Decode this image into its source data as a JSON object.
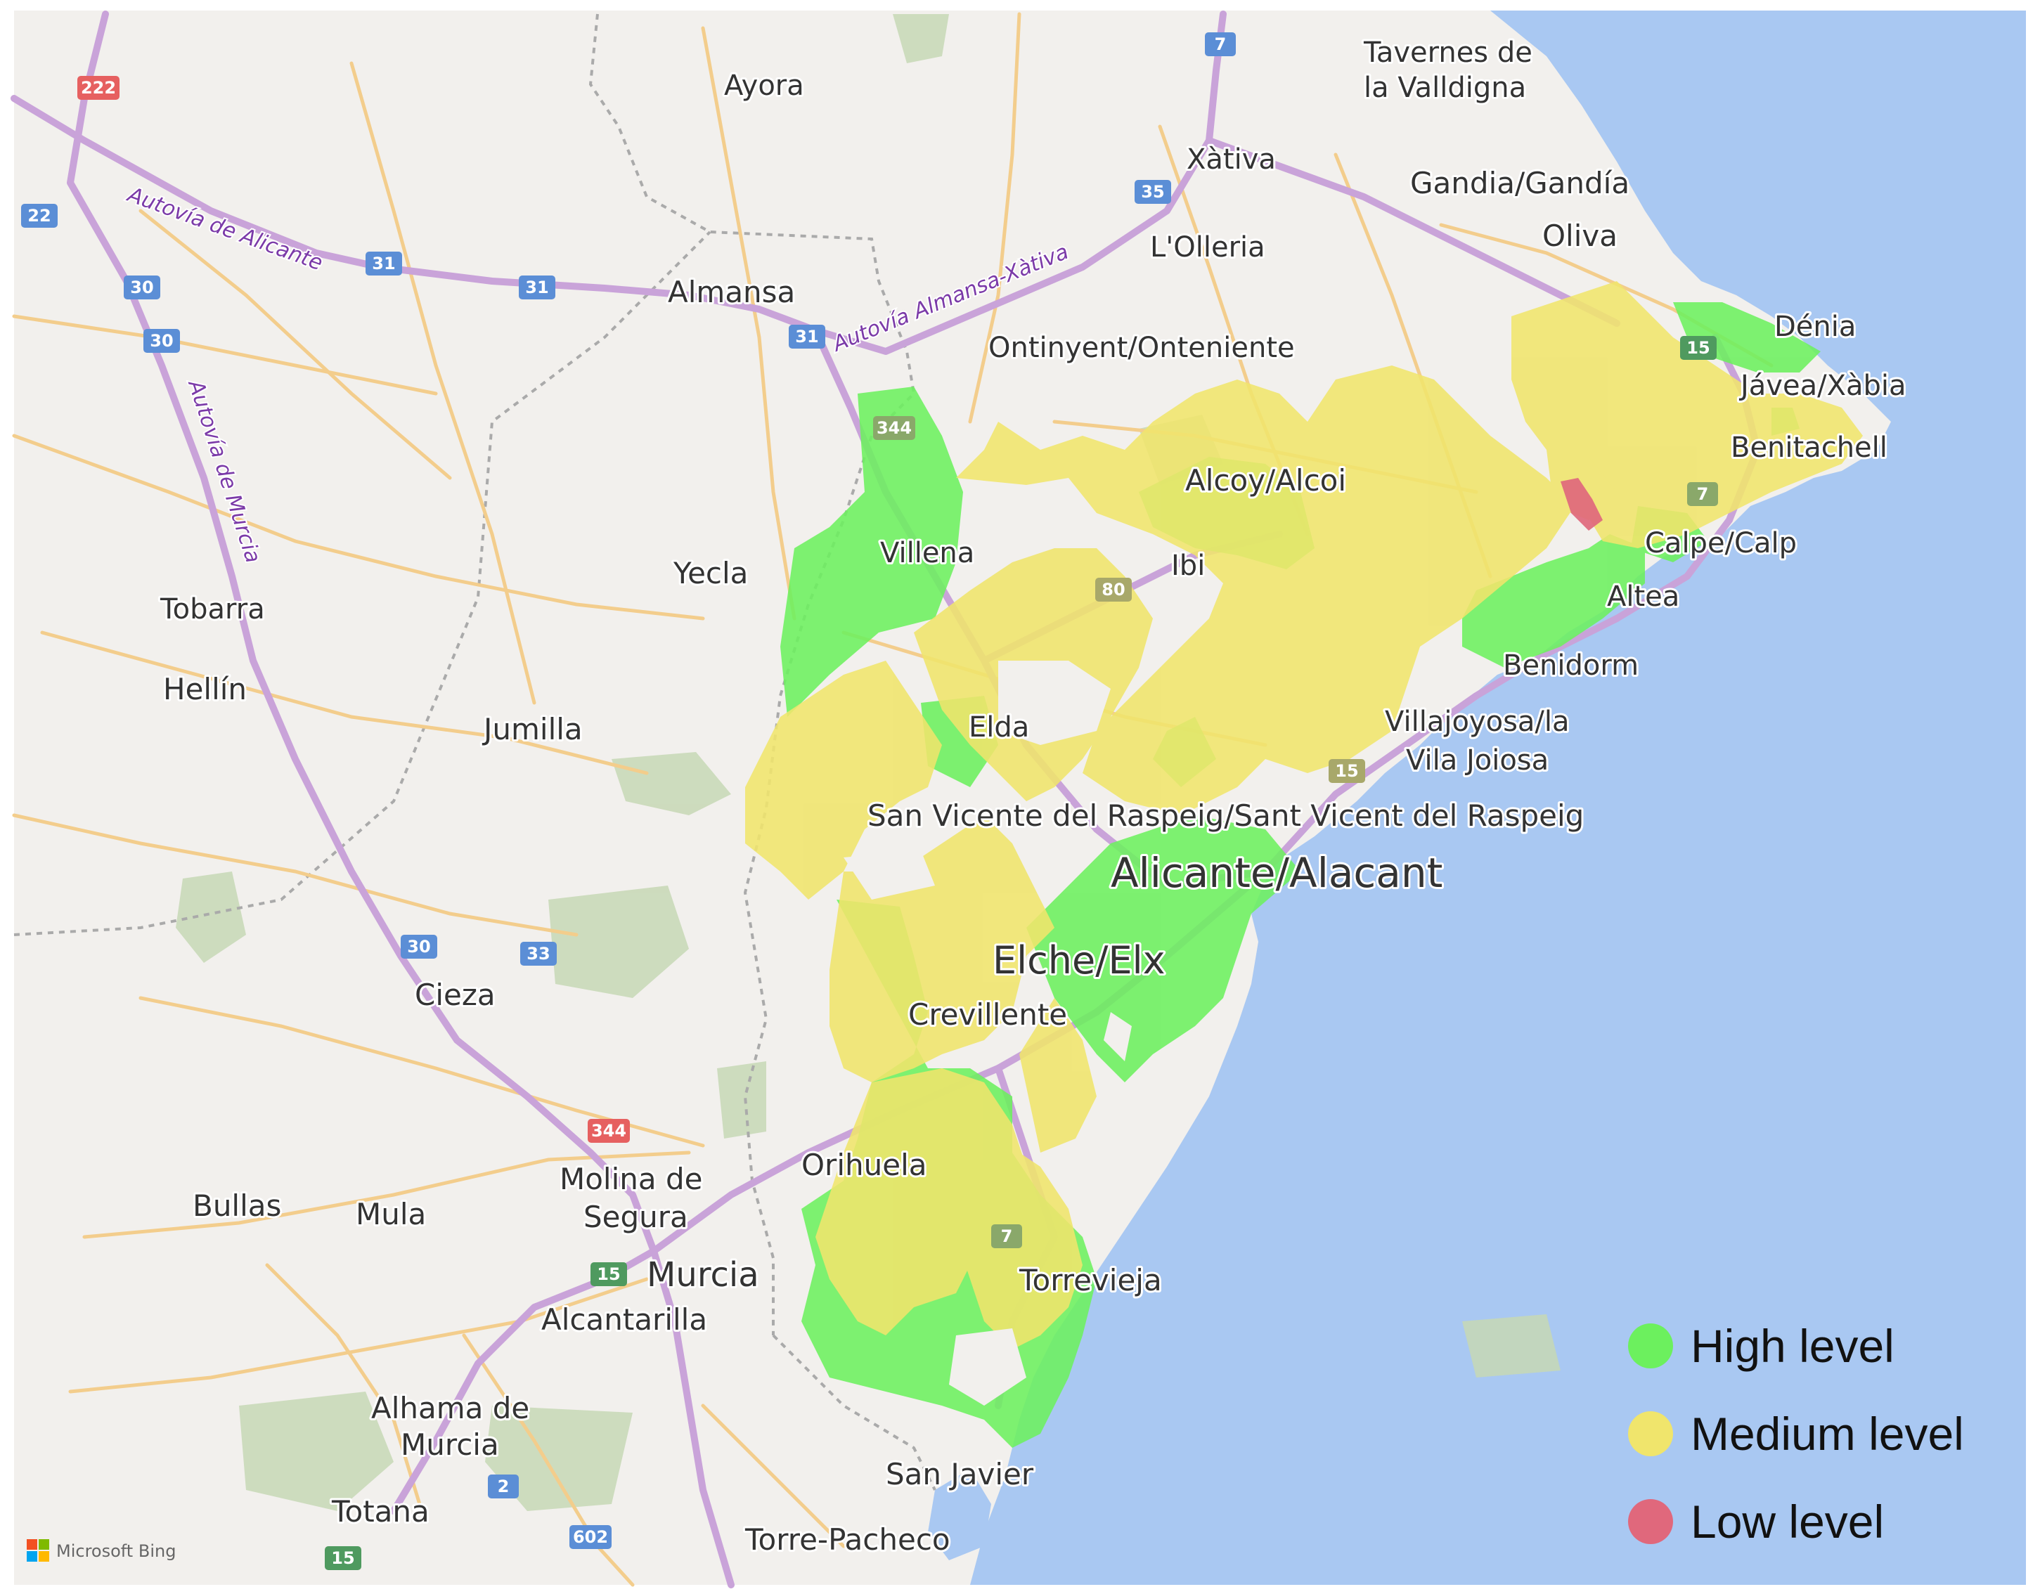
{
  "colors": {
    "sea": "#a9c8f2",
    "land": "#f2f0ed",
    "high": "#6cf05e",
    "medium": "#f0e56c",
    "low": "#e0687c",
    "motorway": "#c9a3d9",
    "road": "#f3cd8c",
    "park": "#c7d8b5"
  },
  "places": {
    "tavernes": [
      "Tavernes de",
      "la Valldigna"
    ],
    "ayora": "Ayora",
    "xativa": "Xàtiva",
    "gandia": "Gandia/Gandía",
    "oliva": "Oliva",
    "lolleria": "L'Olleria",
    "almansa": "Almansa",
    "ontinyent": "Ontinyent/Onteniente",
    "denia": "Dénia",
    "javea": "Jávea/Xàbia",
    "benitachell": "Benitachell",
    "alcoy": "Alcoy/Alcoi",
    "villena": "Villena",
    "ibi": "Ibi",
    "calpe": "Calpe/Calp",
    "yecla": "Yecla",
    "altea": "Altea",
    "tobarra": "Tobarra",
    "benidorm": "Benidorm",
    "hellin": "Hellín",
    "jumilla": "Jumilla",
    "elda": "Elda",
    "villajoyosa": [
      "Villajoyosa/la",
      "Vila Joiosa"
    ],
    "sanvicente": "San Vicente del Raspeig/Sant Vicent del Raspeig",
    "alicante": "Alicante/Alacant",
    "elche": "Elche/Elx",
    "cieza": "Cieza",
    "crevillente": "Crevillente",
    "orihuela": "Orihuela",
    "molina": [
      "Molina de",
      "Segura"
    ],
    "bullas": "Bullas",
    "mula": "Mula",
    "murcia": "Murcia",
    "torrevieja": "Torrevieja",
    "alcantarilla": "Alcantarilla",
    "alhama": [
      "Alhama de",
      "Murcia"
    ],
    "sanjavier": "San Javier",
    "totana": "Totana",
    "torrepacheco": "Torre-Pacheco"
  },
  "roads": {
    "autovia_alicante": "Autovía de Alicante",
    "autovia_almansa": "Autovía Almansa-Xàtiva",
    "autovia_murcia": "Autovía de Murcia"
  },
  "shields": [
    "222",
    "22",
    "31",
    "31",
    "30",
    "30",
    "31",
    "7",
    "35",
    "344",
    "80",
    "15",
    "7",
    "15",
    "30",
    "33",
    "344",
    "15",
    "7",
    "2",
    "602",
    "15"
  ],
  "legend": {
    "high": "High level",
    "medium": "Medium level",
    "low": "Low level"
  },
  "attribution": "Microsoft Bing"
}
